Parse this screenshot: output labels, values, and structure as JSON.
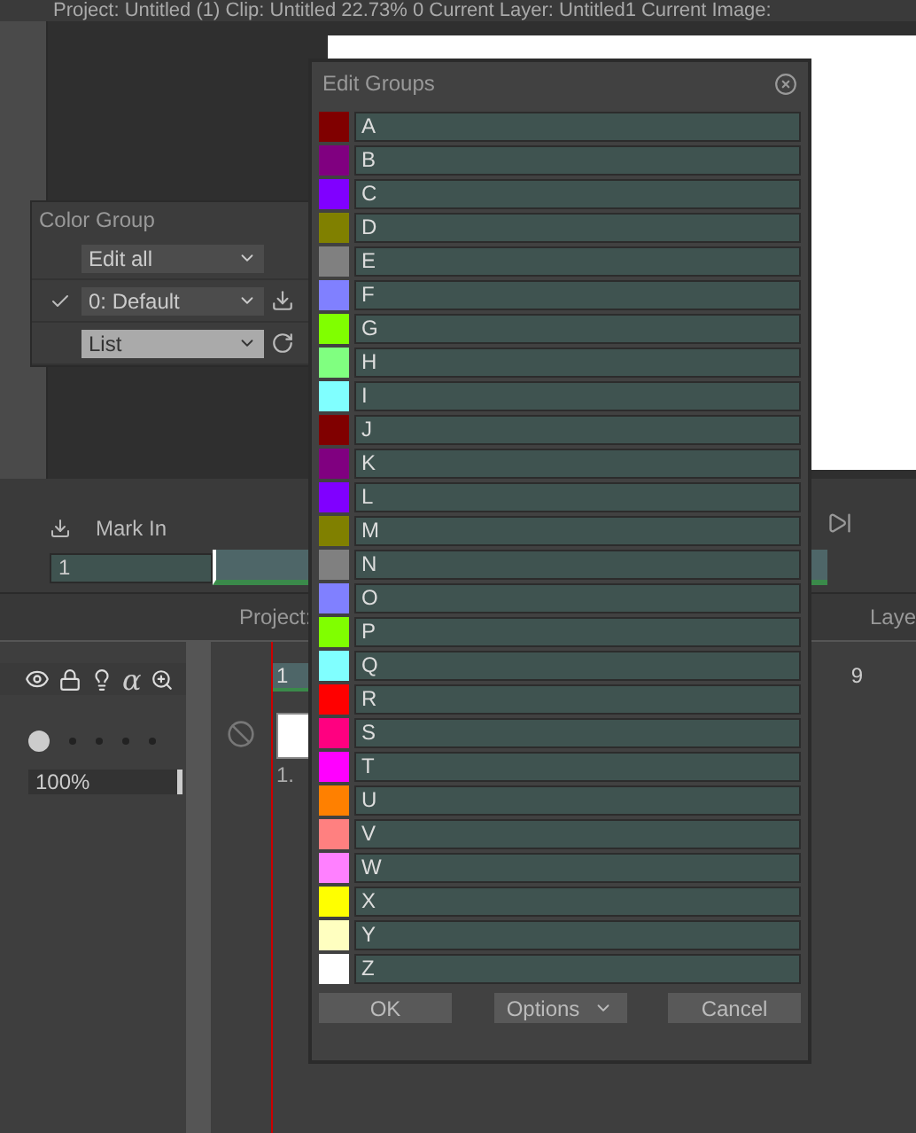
{
  "top_bar": {
    "text": "Project:  Untitled (1)  Clip:  Untitled   22.73%  0   Current Layer:  Untitled1   Current Image:"
  },
  "color_group": {
    "title": "Color Group",
    "mode_dropdown": "Edit all",
    "groups": [
      {
        "label": "0: Default",
        "checked": true
      }
    ],
    "view_dropdown": "List"
  },
  "timeline": {
    "mark_label": "Mark In",
    "frame_field": "1"
  },
  "xsheet": {
    "header": "Project:",
    "header_right": "Laye",
    "alpha_glyph": "α",
    "zoom_field": "100%",
    "column_frame": "1",
    "cell_text": "1.",
    "frame_tick": "9"
  },
  "dialog": {
    "title": "Edit Groups",
    "groups": [
      {
        "label": "A",
        "color": "#800000"
      },
      {
        "label": "B",
        "color": "#800080"
      },
      {
        "label": "C",
        "color": "#8000ff"
      },
      {
        "label": "D",
        "color": "#808000"
      },
      {
        "label": "E",
        "color": "#808080"
      },
      {
        "label": "F",
        "color": "#8080ff"
      },
      {
        "label": "G",
        "color": "#80ff00"
      },
      {
        "label": "H",
        "color": "#80ff80"
      },
      {
        "label": "I",
        "color": "#80ffff"
      },
      {
        "label": "J",
        "color": "#800000"
      },
      {
        "label": "K",
        "color": "#800080"
      },
      {
        "label": "L",
        "color": "#8000ff"
      },
      {
        "label": "M",
        "color": "#808000"
      },
      {
        "label": "N",
        "color": "#808080"
      },
      {
        "label": "O",
        "color": "#8080ff"
      },
      {
        "label": "P",
        "color": "#80ff00"
      },
      {
        "label": "Q",
        "color": "#80ffff"
      },
      {
        "label": "R",
        "color": "#ff0000"
      },
      {
        "label": "S",
        "color": "#ff0080"
      },
      {
        "label": "T",
        "color": "#ff00ff"
      },
      {
        "label": "U",
        "color": "#ff8000"
      },
      {
        "label": "V",
        "color": "#ff8080"
      },
      {
        "label": "W",
        "color": "#ff80ff"
      },
      {
        "label": "X",
        "color": "#ffff00"
      },
      {
        "label": "Y",
        "color": "#ffffc0"
      },
      {
        "label": "Z",
        "color": "#ffffff"
      }
    ],
    "buttons": [
      {
        "label": "OK",
        "kind": "plain"
      },
      {
        "label": "Options",
        "kind": "dropdown"
      },
      {
        "label": "Cancel",
        "kind": "plain"
      }
    ]
  }
}
